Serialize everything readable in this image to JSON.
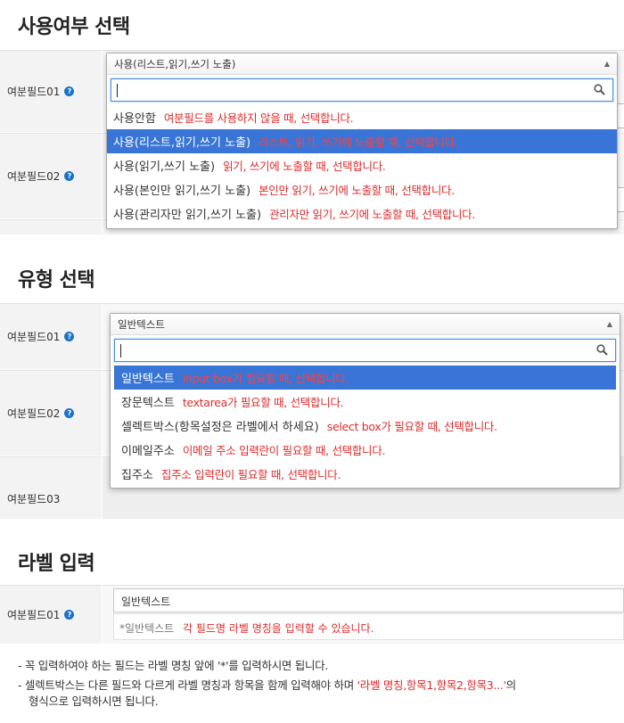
{
  "section1": {
    "title": "사용여부 선택",
    "fields": [
      "여분필드01",
      "여분필드02"
    ],
    "dropdown": {
      "selected": "사용(리스트,읽기,쓰기 노출)",
      "options": [
        {
          "label": "사용안함",
          "desc": "여분필드를 사용하지 않을 때, 선택합니다."
        },
        {
          "label": "사용(리스트,읽기,쓰기 노출)",
          "desc": "리스트, 읽기, 쓰기에 노출할 때, 선택합니다."
        },
        {
          "label": "사용(읽기,쓰기 노출)",
          "desc": "읽기, 쓰기에 노출할 때, 선택합니다."
        },
        {
          "label": "사용(본인만 읽기,쓰기 노출)",
          "desc": "본인만 읽기, 쓰기에 노출할 때, 선택합니다."
        },
        {
          "label": "사용(관리자만 읽기,쓰기 노출)",
          "desc": "관리자만 읽기, 쓰기에 노출할 때, 선택합니다."
        }
      ]
    }
  },
  "section2": {
    "title": "유형 선택",
    "fields": [
      "여분필드01",
      "여분필드02",
      "여분필드03"
    ],
    "dropdown": {
      "selected": "일반텍스트",
      "options": [
        {
          "label": "일반텍스트",
          "desc": "input box가 필요할 때, 선택합니다."
        },
        {
          "label": "장문텍스트",
          "desc": "textarea가 필요할 때, 선택합니다."
        },
        {
          "label": "셀렉트박스(항목설정은 라벨에서 하세요)",
          "desc": "select box가 필요할 때, 선택합니다."
        },
        {
          "label": "이메일주소",
          "desc": "이메일 주소 입력란이 필요할 때, 선택합니다."
        },
        {
          "label": "집주소",
          "desc": "집주소 입력란이 필요할 때, 선택합니다."
        }
      ]
    }
  },
  "section3": {
    "title": "라벨 입력",
    "field": "여분필드01",
    "input_value": "일반텍스트",
    "hint_value": "*일반텍스트",
    "hint_desc": "각 필드명 라벨 명칭을 입력할 수 있습니다."
  },
  "notes": {
    "n1": "- 꼭 입력하여야 하는 필드는 라벨 명칭 앞에 '*'를 입력하시면 됩니다.",
    "n2_a": "- 셀렉트박스는 다른 필드와 다르게 라벨 명칭과 항목을 함께 입력해야 하며",
    "n2_b": "'라벨 명칭,항목1,항목2,항목3...'",
    "n2_c": "의",
    "n2_d": "형식으로 입력하시면 됩니다."
  },
  "colors": {
    "accent": "#3875d7",
    "desc_red": "#e02a2a",
    "help_blue": "#1a73c8"
  },
  "icons": {
    "search": "search-icon",
    "help": "help-icon",
    "arrow": "triangle-up-icon"
  }
}
